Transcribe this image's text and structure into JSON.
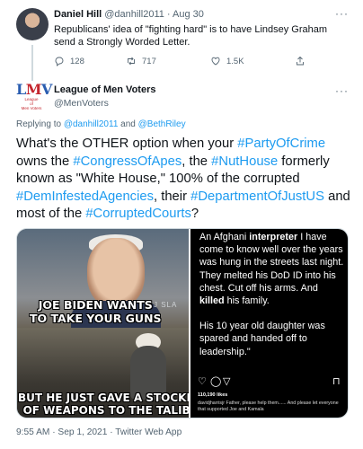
{
  "quoted_tweet": {
    "name": "Daniel Hill",
    "handle_time": "@danhill2011 · Aug 30",
    "text": "Republicans' idea of \"fighting hard\" is to have Lindsey Graham send a Strongly Worded Letter.",
    "replies": "128",
    "retweets": "717",
    "likes": "1.5K",
    "more": "···"
  },
  "author": {
    "logo_text_l": "L",
    "logo_text_m": "M",
    "logo_text_v": "V",
    "logo_sub1": "League",
    "logo_sub2": "of",
    "logo_sub3": "Men Voters",
    "name": "League of Men Voters",
    "handle": "@MenVoters",
    "more": "···"
  },
  "reply_to": {
    "prefix": "Replying to",
    "user1": "@danhill2011",
    "conj": "and",
    "user2": "@BethRiley"
  },
  "tweet": {
    "t1": "What's the OTHER option when your ",
    "h1": "#PartyOfCrime",
    "t2": " owns the ",
    "h2": "#CongressOfApes",
    "t3": ", the ",
    "h3": "#NutHouse",
    "t4": " formerly known as \"White House,\" 100% of the corrupted ",
    "h4": "#DemInfestedAgencies",
    "t5": ", their ",
    "h5": "#DepartmentOfJustUS",
    "t6": " and most of the ",
    "h6": "#CorruptedCourts",
    "t7": "?"
  },
  "media": {
    "left": {
      "caption_top_1": "JOE BIDEN WANTS",
      "caption_top_2": "TO TAKE YOUR GUNS",
      "caption_bottom_1": "BUT HE JUST GAVE A STOCKPILE",
      "caption_bottom_2": "OF WEAPONS TO THE TALIBAN",
      "watermark": "J SLA"
    },
    "right": {
      "p1_a": "An Afghani ",
      "p1_b": "interpreter",
      "p1_c": " I have come to know well over the years was hung in the streets last night. They melted his DoD ID into his chest. Cut off his arms. And ",
      "p1_d": "killed",
      "p1_e": " his family.",
      "p2": "His 10 year old daughter was spared and handed off to leadership.\"",
      "likes": "110,190 likes",
      "caption": "davidjharrisjr Father, please help them...... And please let everyone that supported Joe and Kamala"
    }
  },
  "timestamp": "9:55 AM · Sep 1, 2021 · Twitter Web App",
  "colors": {
    "link": "#1d9bf0",
    "muted": "#536471",
    "text": "#0f1419"
  }
}
